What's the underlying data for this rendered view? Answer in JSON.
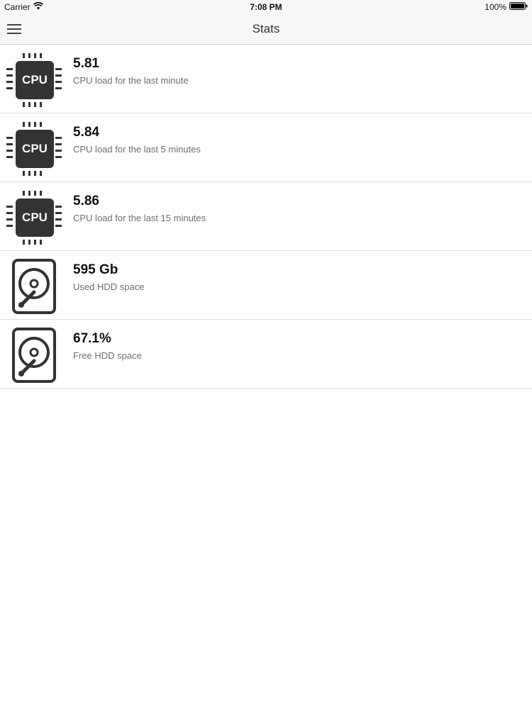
{
  "status_bar": {
    "carrier": "Carrier",
    "time": "7:08 PM",
    "battery": "100%"
  },
  "nav": {
    "title": "Stats"
  },
  "stats": [
    {
      "value": "5.81",
      "label": "CPU load for the last minute",
      "icon": "cpu-icon",
      "icon_text": "CPU"
    },
    {
      "value": "5.84",
      "label": "CPU load for the last 5 minutes",
      "icon": "cpu-icon",
      "icon_text": "CPU"
    },
    {
      "value": "5.86",
      "label": "CPU load for the last 15 minutes",
      "icon": "cpu-icon",
      "icon_text": "CPU"
    },
    {
      "value": "595 Gb",
      "label": "Used HDD space",
      "icon": "hdd-icon"
    },
    {
      "value": "67.1%",
      "label": "Free HDD space",
      "icon": "hdd-icon"
    }
  ],
  "colors": {
    "icon": "#333333",
    "bar_background": "#f7f7f8",
    "separator": "#e0e0e0"
  }
}
